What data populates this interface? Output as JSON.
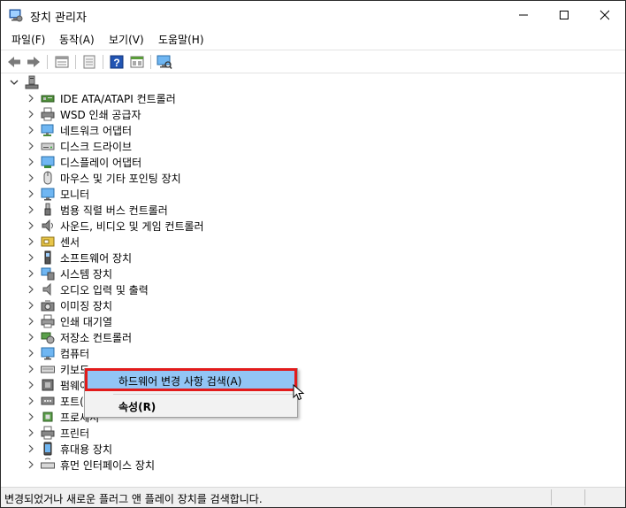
{
  "window": {
    "title": "장치 관리자",
    "controls": {
      "minimize": "minimize-icon",
      "maximize": "maximize-icon",
      "close": "close-icon"
    }
  },
  "menu": [
    {
      "label": "파일(F)"
    },
    {
      "label": "동작(A)"
    },
    {
      "label": "보기(V)"
    },
    {
      "label": "도움말(H)"
    }
  ],
  "toolbar": {
    "buttons": [
      "back-icon",
      "forward-icon",
      "properties-icon",
      "update-driver-icon",
      "help-icon",
      "show-hidden-icon",
      "scan-hardware-icon"
    ]
  },
  "tree": {
    "root_icon": "computer-icon",
    "items": [
      {
        "label": "IDE ATA/ATAPI 컨트롤러",
        "icon": "ide-controller-icon"
      },
      {
        "label": "WSD 인쇄 공급자",
        "icon": "printer-icon"
      },
      {
        "label": "네트워크 어댑터",
        "icon": "network-adapter-icon"
      },
      {
        "label": "디스크 드라이브",
        "icon": "disk-drive-icon"
      },
      {
        "label": "디스플레이 어댑터",
        "icon": "display-adapter-icon"
      },
      {
        "label": "마우스 및 기타 포인팅 장치",
        "icon": "mouse-icon"
      },
      {
        "label": "모니터",
        "icon": "monitor-icon"
      },
      {
        "label": "범용 직렬 버스 컨트롤러",
        "icon": "usb-icon"
      },
      {
        "label": "사운드, 비디오 및 게임 컨트롤러",
        "icon": "sound-icon"
      },
      {
        "label": "센서",
        "icon": "sensor-icon"
      },
      {
        "label": "소프트웨어 장치",
        "icon": "software-device-icon"
      },
      {
        "label": "시스템 장치",
        "icon": "system-device-icon"
      },
      {
        "label": "오디오 입력 및 출력",
        "icon": "audio-icon"
      },
      {
        "label": "이미징 장치",
        "icon": "imaging-device-icon"
      },
      {
        "label": "인쇄 대기열",
        "icon": "print-queue-icon"
      },
      {
        "label": "저장소 컨트롤러",
        "icon": "storage-controller-icon"
      },
      {
        "label": "컴퓨터",
        "icon": "computer-icon"
      },
      {
        "label": "키보드",
        "icon": "keyboard-icon"
      },
      {
        "label": "펌웨어",
        "icon": "firmware-icon"
      },
      {
        "label": "포트(COM & LPT)",
        "icon": "port-icon"
      },
      {
        "label": "프로세서",
        "icon": "processor-icon"
      },
      {
        "label": "프린터",
        "icon": "printer-icon"
      },
      {
        "label": "휴대용 장치",
        "icon": "portable-device-icon"
      },
      {
        "label": "휴먼 인터페이스 장치",
        "icon": "hid-icon"
      }
    ]
  },
  "context_menu": {
    "items": [
      {
        "label": "하드웨어 변경 사항 검색(A)",
        "highlighted": true
      },
      {
        "label": "속성(R)",
        "bold": true
      }
    ]
  },
  "status": {
    "text": "변경되었거나 새로운 플러그 앤 플레이 장치를 검색합니다."
  },
  "colors": {
    "highlight": "#92c5f5",
    "annotation_border": "#e21b1b",
    "menu_background": "#f2f2f2"
  }
}
